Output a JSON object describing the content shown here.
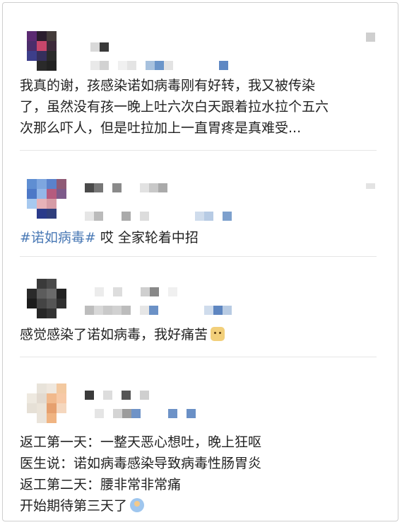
{
  "comments": [
    {
      "author": "",
      "lines": [
        "我真的谢，孩感染诺如病毒刚有好转，我又被传染",
        "了，虽然没有孩一晚上吐六次白天跟着拉水拉个五六",
        "次那么吓人，但是吐拉加上一直胃疼是真难受..."
      ]
    },
    {
      "author": "",
      "hashtag": "#诺如病毒#",
      "text": " 哎 全家轮着中招"
    },
    {
      "author": "",
      "text": "感觉感染了诺如病毒，我好痛苦",
      "emoji": "cat-face-emoji"
    },
    {
      "author": "",
      "lines": [
        "返工第一天：一整天恶心想吐，晚上狂呕",
        "医生说：诺如病毒感染导致病毒性肠胃炎",
        "返工第二天：腰非常非常痛",
        "开始期待第三天了"
      ],
      "emoji": "waving-person-emoji"
    }
  ],
  "colors": {
    "hashtag": "#4a79b5",
    "text": "#222222",
    "divider": "#e6e6e6"
  }
}
